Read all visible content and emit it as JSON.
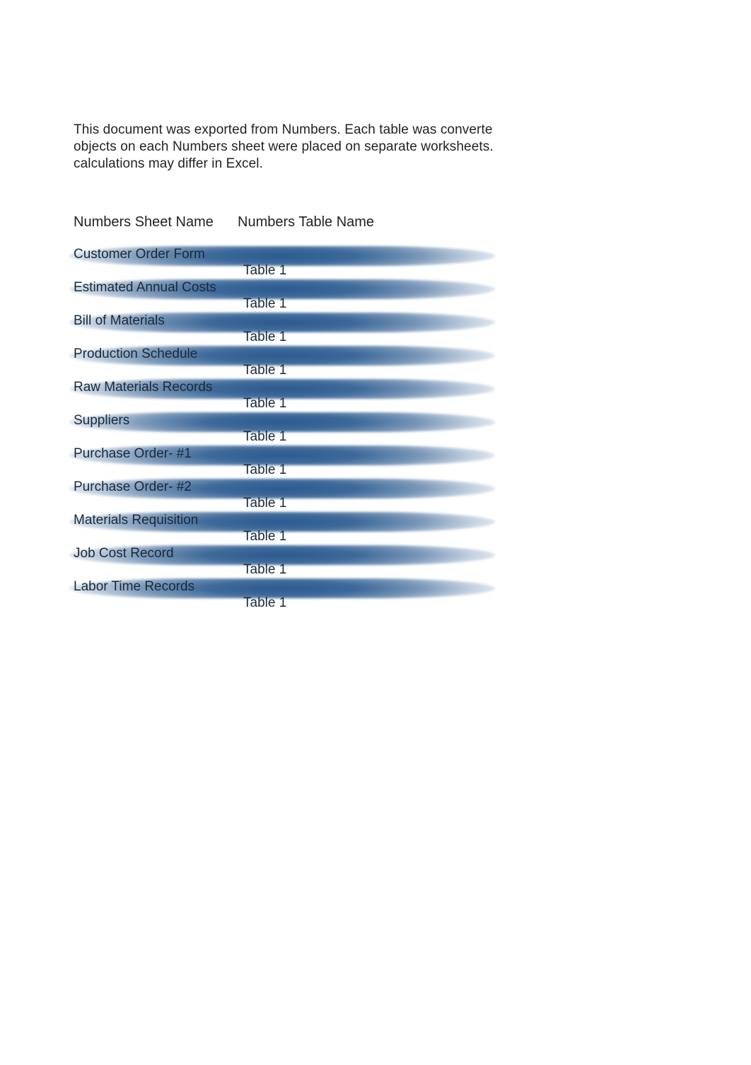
{
  "intro": {
    "line1": "This document was exported from Numbers.  Each table was converte",
    "line2": "objects on each Numbers sheet were placed on separate worksheets.",
    "line3": "calculations may differ in Excel."
  },
  "headers": {
    "sheet": "Numbers Sheet Name",
    "table": "Numbers Table Name"
  },
  "rows": [
    {
      "sheet": "Customer Order Form",
      "table": "Table 1"
    },
    {
      "sheet": "Estimated Annual Costs",
      "table": "Table 1"
    },
    {
      "sheet": "Bill of Materials",
      "table": "Table 1"
    },
    {
      "sheet": "Production Schedule",
      "table": "Table 1"
    },
    {
      "sheet": "Raw Materials Records",
      "table": "Table 1"
    },
    {
      "sheet": "Suppliers",
      "table": "Table 1"
    },
    {
      "sheet": "Purchase Order- #1",
      "table": "Table 1"
    },
    {
      "sheet": "Purchase Order- #2",
      "table": "Table 1"
    },
    {
      "sheet": "Materials Requisition",
      "table": "Table 1"
    },
    {
      "sheet": "Job Cost Record",
      "table": "Table 1"
    },
    {
      "sheet": "Labor Time Records",
      "table": "Table 1"
    }
  ]
}
